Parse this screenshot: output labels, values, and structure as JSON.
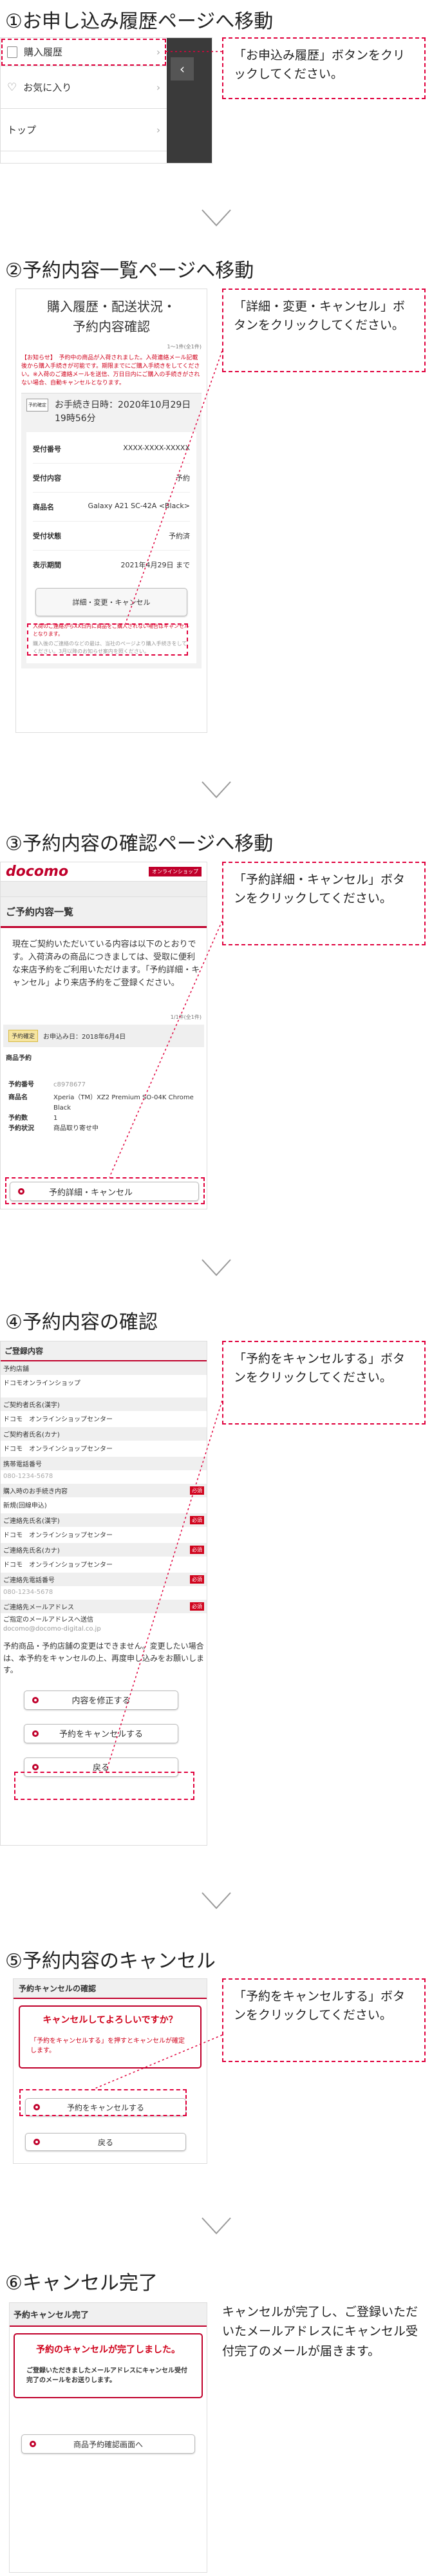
{
  "step1": {
    "title": "①お申し込み履歴ページへ移動",
    "menu": [
      "購入履歴",
      "お気に入り",
      "トップ"
    ],
    "note": "「お申込み履歴」ボタンをクリックしてください。"
  },
  "step2": {
    "title": "②予約内容一覧ページへ移動",
    "heading_line1": "購入履歴・配送状況・",
    "heading_line2": "予約内容確認",
    "count": "1〜1件(全1件)",
    "notice": "【お知らせ】　予約中の商品が入荷されました。入荷連絡メール記載後から購入手続きが可能です。期限までにご購入手続きをしてください。※入荷のご連絡メールを送信、万日日内にご購入の手続きがされない場合、自動キャンセルとなります。",
    "order_badge": "予約確定",
    "order_date_label": "お手続き日時：",
    "order_date": "2020年10月29日",
    "order_time": "19時56分",
    "rows": [
      {
        "label": "受付番号",
        "value": "XXXX-XXXX-XXXXX"
      },
      {
        "label": "受付内容",
        "value": "予約"
      },
      {
        "label": "商品名",
        "value": "Galaxy A21 SC-42A <Black>"
      },
      {
        "label": "受付状態",
        "value": "予約済"
      },
      {
        "label": "表示期間",
        "value": "2021年4月29日 まで"
      }
    ],
    "button": "詳細・変更・キャンセル",
    "foot_red": "入荷のご連絡からXX日内に商品をご購入されない場合はキャンセルとなります。",
    "foot_gray": "購入後のご連絡のなどの最は、当社のページより購入手続きをしてください。3月以降のお知らせ案内を照ください。",
    "note": "「詳細・変更・キャンセル」ボタンをクリックしてください。"
  },
  "step3": {
    "title": "③予約内容の確認ページへ移動",
    "logo": "docomo",
    "logo_badge": "オンラインショップ",
    "section": "ご予約内容一覧",
    "intro": "現在ご契約いただいている内容は以下のとおりです。入荷済みの商品につきましては、受取に便利な来店予約をご利用いただけます。「予約詳細・キャンセル」より来店予約をご登録ください。",
    "count": "1/1件(全1件)",
    "badge": "予約確定",
    "date": "お申込み日：2018年6月4日",
    "product_header": "商品予約",
    "rows": [
      {
        "label": "予約番号",
        "value": "c8978677"
      },
      {
        "label": "商品名",
        "value": "Xperia（TM）XZ2 Premium SO-04K Chrome Black"
      },
      {
        "label": "予約数",
        "value": "1"
      },
      {
        "label": "予約状況",
        "value": "商品取り寄せ中"
      }
    ],
    "button": "予約詳細・キャンセル",
    "note": "「予約詳細・キャンセル」ボタンをクリックしてください。"
  },
  "step4": {
    "title": "④予約内容の確認",
    "section": "ご登録内容",
    "fields": [
      {
        "label": "予約店舗",
        "value": "ドコモオンラインショップ",
        "req": false
      },
      {
        "label": "ご契約者氏名(漢字)",
        "value": "ドコモ　オンラインショップセンター",
        "req": false
      },
      {
        "label": "ご契約者氏名(カナ)",
        "value": "ドコモ　オンラインショップセンター",
        "req": false
      },
      {
        "label": "携帯電話番号",
        "value": "080-1234-5678",
        "req": false
      },
      {
        "label": "購入時のお手続き内容",
        "value": "新規(回線申込)",
        "req": true
      },
      {
        "label": "ご連絡先氏名(漢字)",
        "value": "ドコモ　オンラインショップセンター",
        "req": true
      },
      {
        "label": "ご連絡先氏名(カナ)",
        "value": "ドコモ　オンラインショップセンター",
        "req": true
      },
      {
        "label": "ご連絡先電話番号",
        "value": "080-1234-5678",
        "req": true
      },
      {
        "label": "ご連絡先メールアドレス",
        "value": "",
        "req": true
      }
    ],
    "req_label": "必須",
    "mail_note": "ご指定のメールアドレスへ送信",
    "mail_value": "docomo@docomo-digital.co.jp",
    "info": "予約商品・予約店舗の変更はできません。変更したい場合は、本予約をキャンセルの上、再度申し込みをお願いします。",
    "btn_modify": "内容を修正する",
    "btn_cancel": "予約をキャンセルする",
    "btn_back": "戻る",
    "note": "「予約をキャンセルする」ボタンをクリックしてください。"
  },
  "step5": {
    "title": "⑤予約内容のキャンセル",
    "section": "予約キャンセルの確認",
    "confirm_title": "キャンセルしてよろしいですか？",
    "confirm_text": "「予約をキャンセルする」を押すとキャンセルが確定します。",
    "btn_cancel": "予約をキャンセルする",
    "btn_back": "戻る",
    "note": "「予約をキャンセルする」ボタンをクリックしてください。"
  },
  "step6": {
    "title": "⑥キャンセル完了",
    "section": "予約キャンセル完了",
    "done_title": "予約のキャンセルが完了しました。",
    "done_text": "ご登録いただきましたメールアドレスにキャンセル受付完了のメールをお送りします。",
    "btn_back": "商品予約確認画面へ",
    "note": "キャンセルが完了し、ご登録いただいたメールアドレスにキャンセル受付完了のメールが届きます。"
  },
  "colors": {
    "accent": "#e0003c",
    "docomo_red": "#c0002b"
  }
}
